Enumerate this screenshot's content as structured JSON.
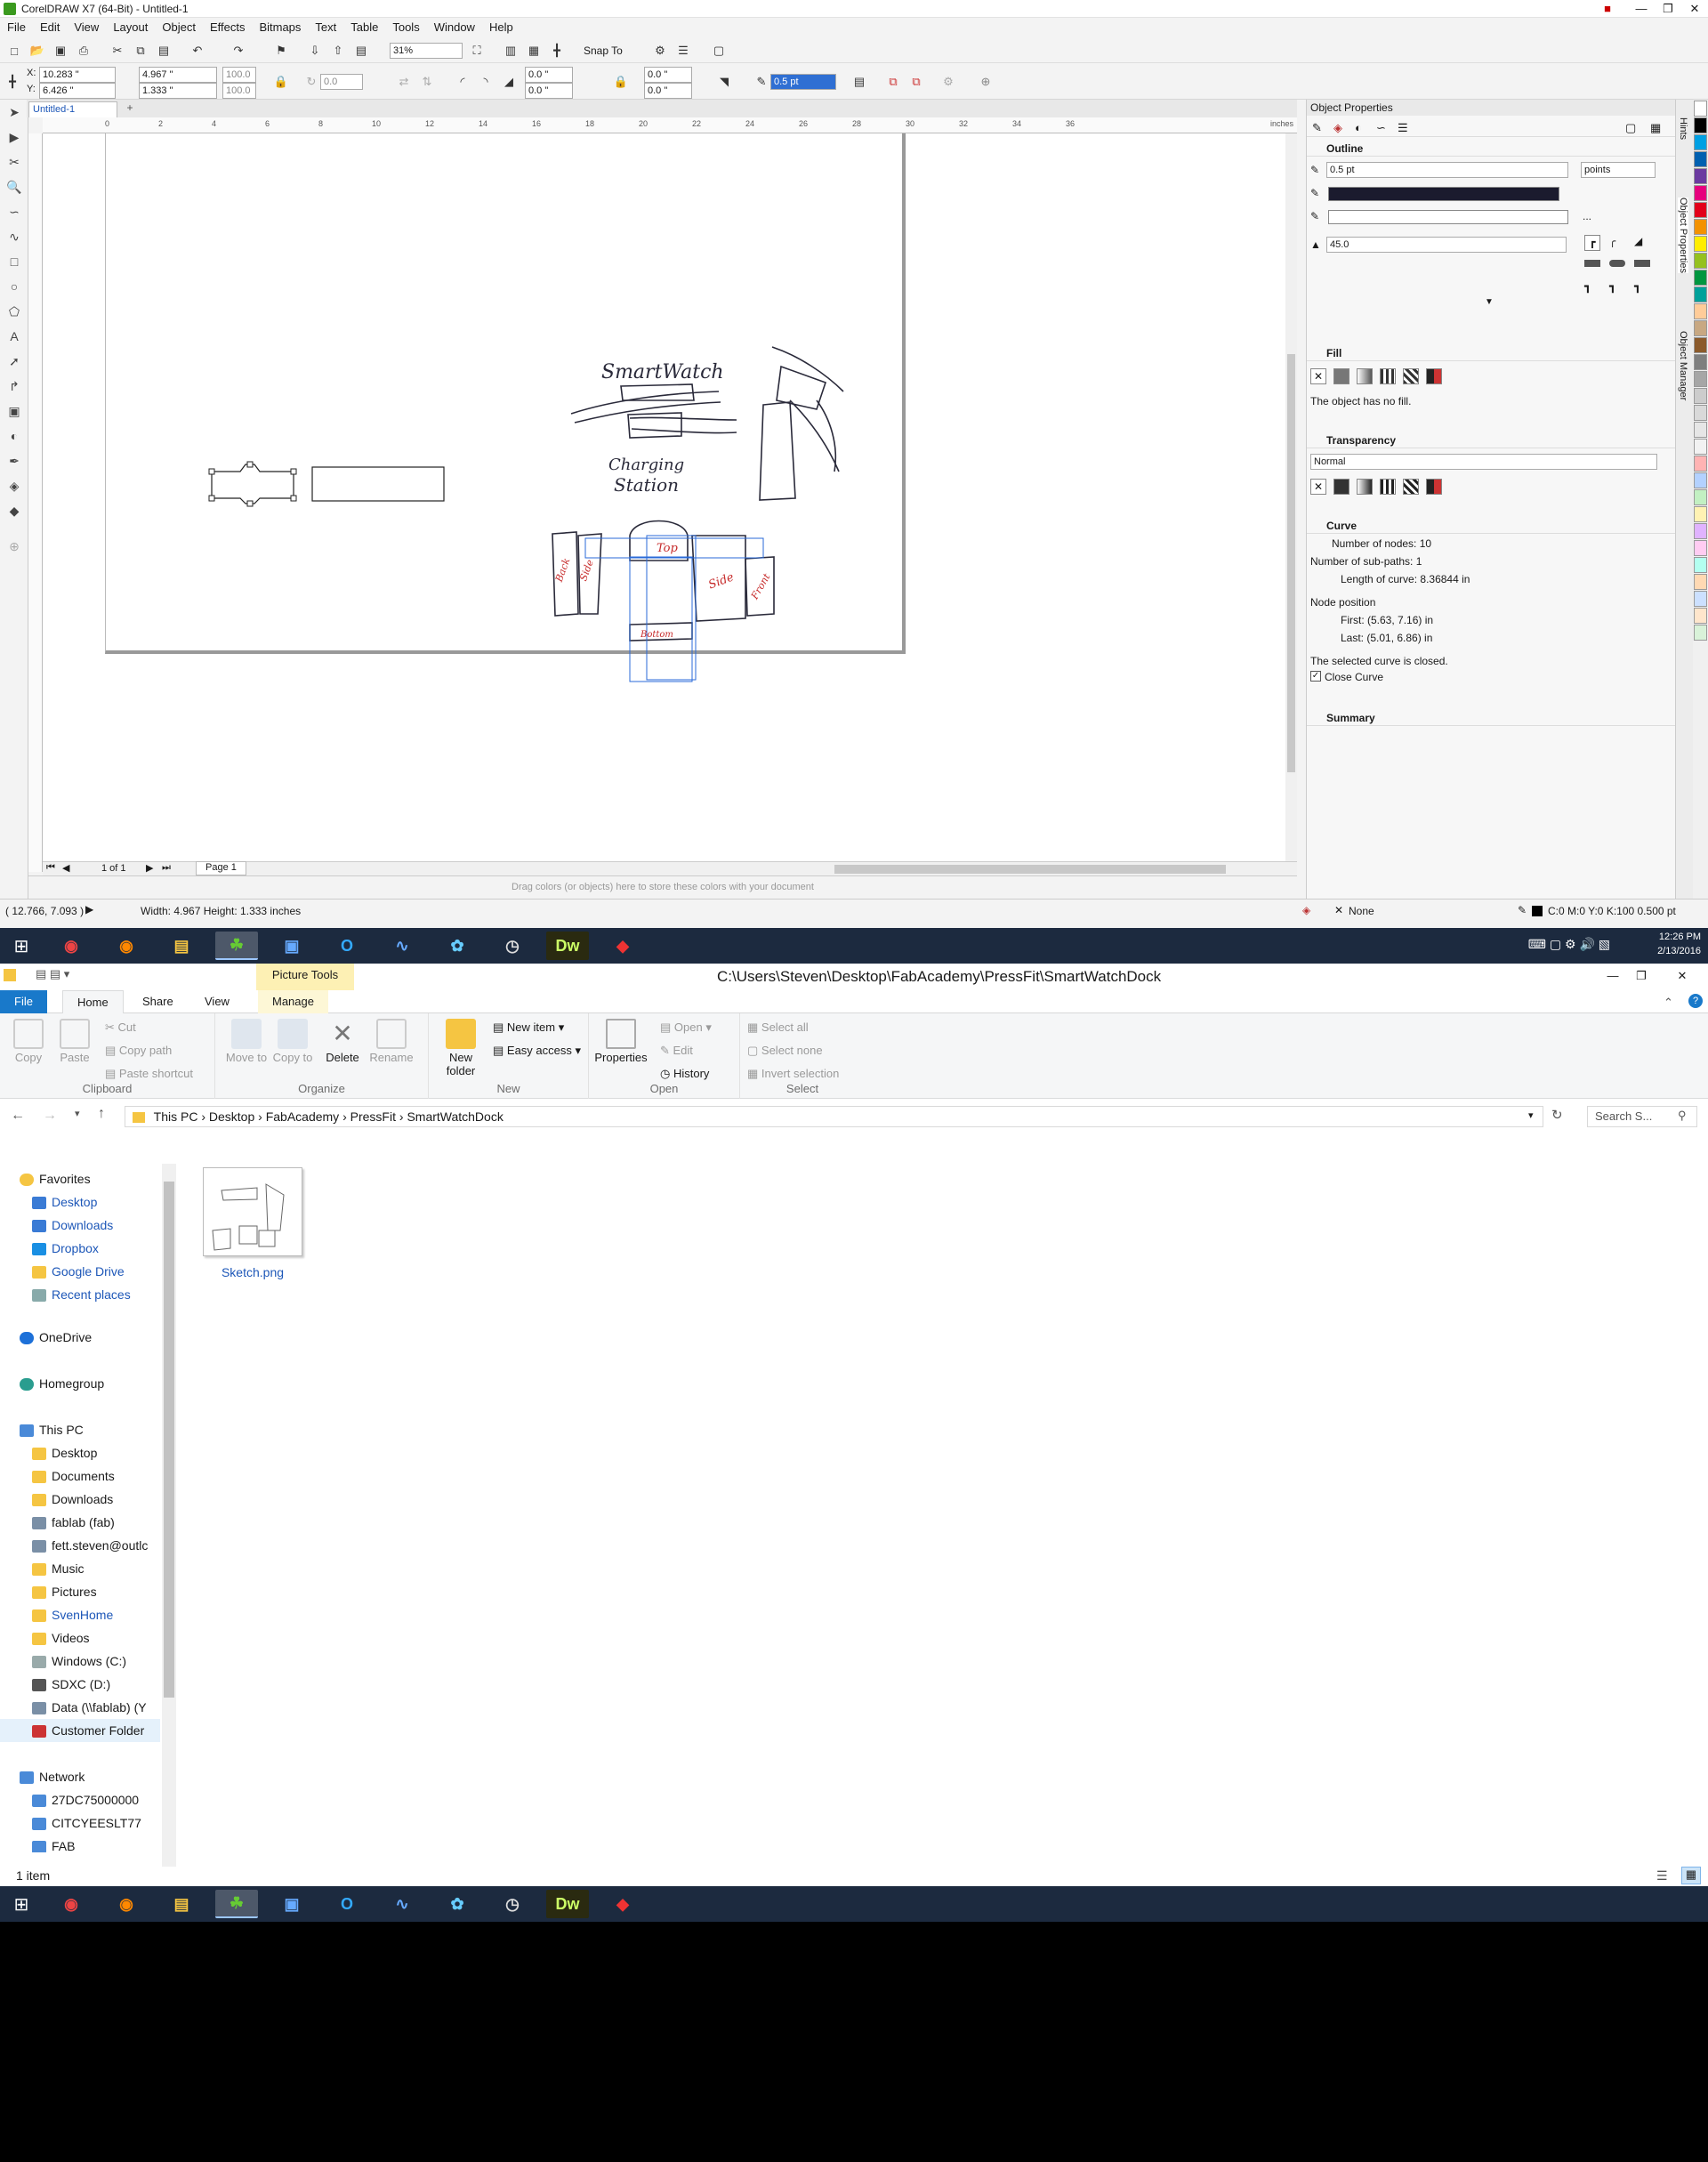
{
  "coreldraw": {
    "title": "CorelDRAW X7 (64-Bit) - Untitled-1",
    "menu": [
      "File",
      "Edit",
      "View",
      "Layout",
      "Object",
      "Effects",
      "Bitmaps",
      "Text",
      "Table",
      "Tools",
      "Window",
      "Help"
    ],
    "standard_bar": {
      "zoom": "31%",
      "snap_to": "Snap To"
    },
    "property_bar": {
      "x": "10.283 \"",
      "y": "6.426 \"",
      "width": "4.967 \"",
      "height": "1.333 \"",
      "scale_w": "100.0",
      "scale_h": "100.0",
      "angle": "0.0",
      "pos1": "0.0 \"",
      "pos2": "0.0 \"",
      "pos3": "0.0 \"",
      "pos4": "0.0 \"",
      "outline_width": "0.5 pt"
    },
    "doc_tab": "Untitled-1",
    "ruler_units": "inches",
    "ruler_marks": [
      "0",
      "2",
      "4",
      "6",
      "8",
      "10",
      "12",
      "14",
      "16",
      "18",
      "20",
      "22",
      "24",
      "26",
      "28",
      "30",
      "32",
      "34",
      "36"
    ],
    "page_nav": {
      "counter": "1 of 1",
      "page_tab": "Page 1"
    },
    "color_strip_hint": "Drag colors (or objects) here to store these colors with your document",
    "status": {
      "cursor": "( 12.766, 7.093 )",
      "dims": "Width: 4.967  Height: 1.333  inches",
      "fill": "None",
      "outline": "C:0 M:0 Y:0 K:100  0.500 pt"
    },
    "sketch_labels": {
      "smartwatch": "SmartWatch",
      "charging": "Charging",
      "station": "Station",
      "top": "Top",
      "back": "Back",
      "side1": "Side",
      "side2": "Side",
      "front": "Front",
      "bottom": "Bottom"
    },
    "docker": {
      "title": "Object Properties",
      "outline": {
        "title": "Outline",
        "width": "0.5 pt",
        "units": "points",
        "miter": "45.0",
        "color_hex": "#1b1b2e",
        "dots": "..."
      },
      "fill": {
        "title": "Fill",
        "note": "The object has no fill."
      },
      "transparency": {
        "title": "Transparency",
        "mode": "Normal"
      },
      "curve": {
        "title": "Curve",
        "nodes": "Number of nodes:  10",
        "subpaths": "Number of sub-paths:  1",
        "length": "Length of curve:  8.36844 in",
        "node_position": "Node position",
        "first": "First:  (5.63, 7.16) in",
        "last": "Last:  (5.01, 6.86) in",
        "closed_note": "The selected curve is closed.",
        "close_curve": "Close Curve"
      },
      "summary": "Summary",
      "side_tabs": [
        "Hints",
        "Object Properties",
        "Object Manager"
      ]
    },
    "palette": [
      "#ffffff",
      "#000000",
      "#00a0e3",
      "#0060b0",
      "#6b3aa0",
      "#e6007e",
      "#e2001a",
      "#f39200",
      "#ffed00",
      "#95c11f",
      "#009640",
      "#00a19a",
      "#ffcc99",
      "#c8a882",
      "#8b5a2b",
      "#7f7f7f",
      "#a6a6a6",
      "#cccccc",
      "#d9d9d9",
      "#e6e6e6",
      "#f2f2f2",
      "#ffb3b3",
      "#b3d1ff",
      "#c2f0c2",
      "#fff2b3",
      "#e0b3ff",
      "#ffccf2",
      "#b3fff0",
      "#ffd9b3",
      "#cce0ff",
      "#ffe6cc",
      "#d9f2d9"
    ]
  },
  "taskbar": {
    "time": "12:26 PM",
    "date": "2/13/2016",
    "apps": [
      "chrome",
      "firefox",
      "explorer",
      "coreldraw",
      "remote",
      "outlook",
      "network",
      "sketch",
      "time",
      "dreamweaver",
      "sketchup"
    ]
  },
  "explorer": {
    "title": "C:\\Users\\Steven\\Desktop\\FabAcademy\\PressFit\\SmartWatchDock",
    "contextual_tab": "Picture Tools",
    "tabs": [
      "File",
      "Home",
      "Share",
      "View",
      "Manage"
    ],
    "ribbon": {
      "clipboard": {
        "label": "Clipboard",
        "copy": "Copy",
        "paste": "Paste",
        "cut": "Cut",
        "copy_path": "Copy path",
        "paste_shortcut": "Paste shortcut"
      },
      "organize": {
        "label": "Organize",
        "move_to": "Move to",
        "copy_to": "Copy to",
        "delete": "Delete",
        "rename": "Rename"
      },
      "new": {
        "label": "New",
        "new_folder": "New folder",
        "new_item": "New item",
        "easy_access": "Easy access"
      },
      "open": {
        "label": "Open",
        "properties": "Properties",
        "open": "Open",
        "edit": "Edit",
        "history": "History"
      },
      "select": {
        "label": "Select",
        "select_all": "Select all",
        "select_none": "Select none",
        "invert": "Invert selection"
      }
    },
    "breadcrumb": [
      "This PC",
      "Desktop",
      "FabAcademy",
      "PressFit",
      "SmartWatchDock"
    ],
    "search_placeholder": "Search S...",
    "nav": {
      "favorites_header": "Favorites",
      "favorites": [
        "Desktop",
        "Downloads",
        "Dropbox",
        "Google Drive",
        "Recent places"
      ],
      "onedrive": "OneDrive",
      "homegroup": "Homegroup",
      "thispc_header": "This PC",
      "thispc": [
        "Desktop",
        "Documents",
        "Downloads",
        "fablab (fab)",
        "fett.steven@outlc",
        "Music",
        "Pictures",
        "SvenHome",
        "Videos",
        "Windows (C:)",
        "SDXC (D:)",
        "Data (\\\\fablab) (Y",
        "Customer Folder"
      ],
      "network_header": "Network",
      "network": [
        "27DC75000000",
        "CITCYEESLT77",
        "FAB"
      ]
    },
    "files": [
      {
        "name": "Sketch.png"
      }
    ],
    "status": "1 item"
  }
}
